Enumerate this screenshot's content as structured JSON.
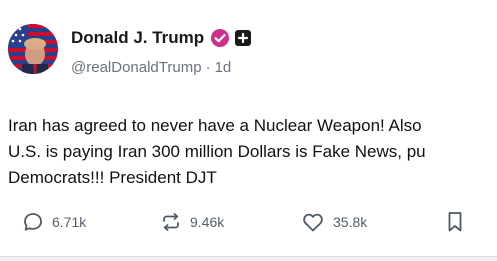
{
  "post": {
    "author": {
      "display_name": "Donald J. Trump",
      "handle": "@realDonaldTrump",
      "separator": "·",
      "time": "1d",
      "verified_color": "#cf2e8d"
    },
    "text_lines": [
      "Iran has agreed to never have a Nuclear Weapon! Also",
      "U.S. is paying Iran 300 million Dollars is Fake News, pu",
      "Democrats!!! President DJT"
    ],
    "actions": {
      "replies": "6.71k",
      "reposts": "9.46k",
      "likes": "35.8k"
    }
  },
  "icons": {
    "reply": "reply-bubble-icon",
    "repost": "repost-arrows-icon",
    "like": "heart-icon",
    "bookmark": "bookmark-icon",
    "verified": "verified-badge-icon",
    "affiliation": "plus-badge-icon"
  }
}
